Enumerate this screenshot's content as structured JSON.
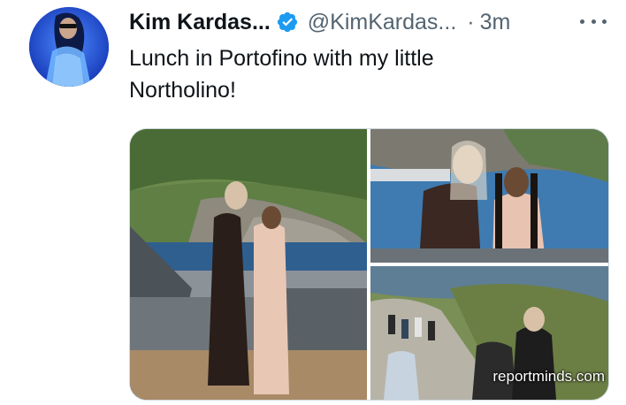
{
  "tweet": {
    "display_name": "Kim Kardas...",
    "handle": "@KimKardas...",
    "separator": "·",
    "time": "3m",
    "text_line1": "Lunch in Portofino with my little",
    "text_line2": "Northolino!"
  },
  "icons": {
    "verified": "verified-badge-icon",
    "more": "more-options-icon"
  },
  "media": {
    "tile_1_description": "photo-yacht",
    "tile_2_description": "photo-portrait",
    "tile_3_description": "photo-crowd",
    "watermark": "reportminds.com"
  },
  "colors": {
    "verified_blue": "#1d9bf0",
    "secondary_text": "#536471",
    "primary_text": "#0f1419",
    "border": "#cfd9de"
  }
}
